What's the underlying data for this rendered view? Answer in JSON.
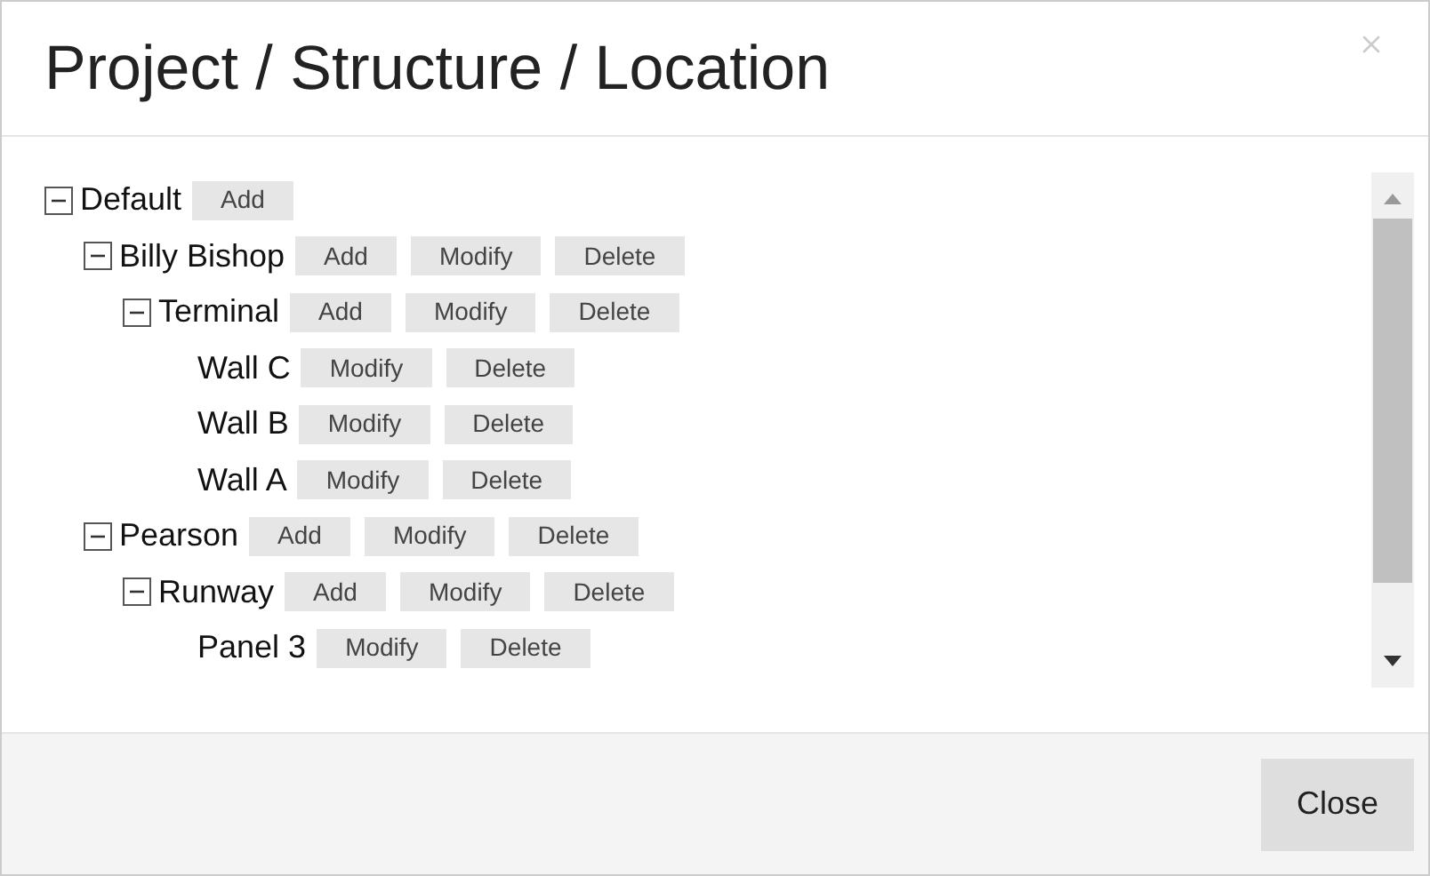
{
  "dialog": {
    "title": "Project / Structure / Location"
  },
  "tree": [
    {
      "label": "Default",
      "expanded": true,
      "actions": [
        "Add"
      ],
      "children": [
        {
          "label": "Billy Bishop",
          "expanded": true,
          "actions": [
            "Add",
            "Modify",
            "Delete"
          ],
          "children": [
            {
              "label": "Terminal",
              "expanded": true,
              "actions": [
                "Add",
                "Modify",
                "Delete"
              ],
              "children": [
                {
                  "label": "Wall C",
                  "actions": [
                    "Modify",
                    "Delete"
                  ]
                },
                {
                  "label": "Wall B",
                  "actions": [
                    "Modify",
                    "Delete"
                  ]
                },
                {
                  "label": "Wall A",
                  "actions": [
                    "Modify",
                    "Delete"
                  ]
                }
              ]
            }
          ]
        },
        {
          "label": "Pearson",
          "expanded": true,
          "actions": [
            "Add",
            "Modify",
            "Delete"
          ],
          "children": [
            {
              "label": "Runway",
              "expanded": true,
              "actions": [
                "Add",
                "Modify",
                "Delete"
              ],
              "children": [
                {
                  "label": "Panel 3",
                  "actions": [
                    "Modify",
                    "Delete"
                  ]
                }
              ]
            }
          ]
        }
      ]
    }
  ],
  "footer": {
    "buttons": [
      "Close"
    ]
  }
}
